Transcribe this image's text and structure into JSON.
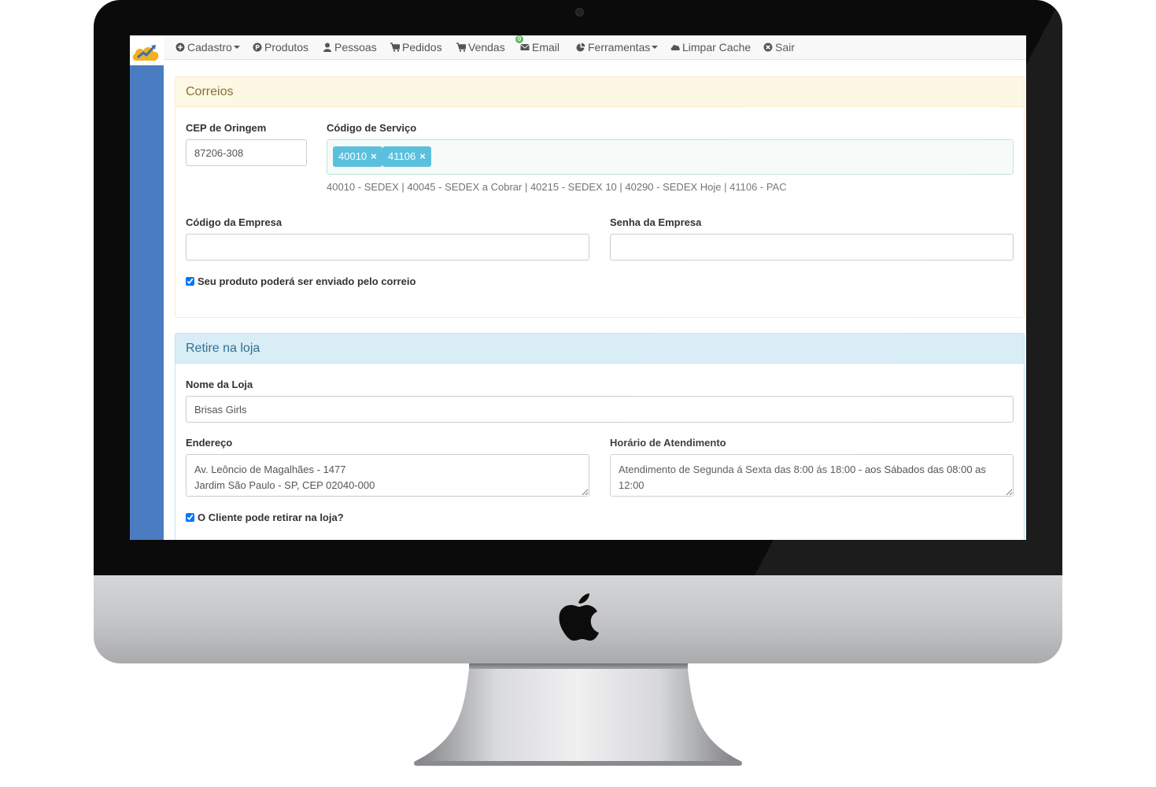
{
  "navbar": {
    "items": [
      {
        "label": "Cadastro",
        "icon": "plus-circle-icon",
        "dropdown": true
      },
      {
        "label": "Produtos",
        "icon": "p-circle-icon",
        "dropdown": false
      },
      {
        "label": "Pessoas",
        "icon": "user-icon",
        "dropdown": false
      },
      {
        "label": "Pedidos",
        "icon": "cart-icon",
        "dropdown": false
      },
      {
        "label": "Vendas",
        "icon": "cart-icon",
        "dropdown": false
      },
      {
        "label": "Email",
        "icon": "envelope-icon",
        "dropdown": false,
        "badge": "0"
      },
      {
        "label": "Ferramentas",
        "icon": "pie-chart-icon",
        "dropdown": true
      },
      {
        "label": "Limpar Cache",
        "icon": "cloud-icon",
        "dropdown": false
      },
      {
        "label": "Sair",
        "icon": "x-circle-icon",
        "dropdown": false
      }
    ]
  },
  "correios": {
    "title": "Correios",
    "cep_label": "CEP de Oringem",
    "cep_value": "87206-308",
    "servico_label": "Código de Serviço",
    "servico_tags": [
      "40010",
      "41106"
    ],
    "servico_help": "40010 - SEDEX | 40045 - SEDEX a Cobrar | 40215 - SEDEX 10 | 40290 - SEDEX Hoje | 41106 - PAC",
    "empresa_label": "Código da Empresa",
    "empresa_value": "",
    "senha_label": "Senha da Empresa",
    "senha_value": "",
    "enviar_checkbox_label": "Seu produto poderá ser enviado pelo correio",
    "enviar_checked": true
  },
  "retire": {
    "title": "Retire na loja",
    "nome_label": "Nome da Loja",
    "nome_value": "Brisas Girls",
    "endereco_label": "Endereço",
    "endereco_value": "Av. Leôncio de Magalhães - 1477\nJardim São Paulo - SP, CEP 02040-000",
    "horario_label": "Horário de Atendimento",
    "horario_value": "Atendimento de Segunda á Sexta das 8:00 ás 18:00 - aos Sábados das 08:00 as 12:00",
    "retirar_checkbox_label": "O Cliente pode retirar na loja?",
    "retirar_checked": true
  },
  "colors": {
    "sidebar": "#4a7cc1",
    "tag": "#5bc0de",
    "warning_heading": "#fcf8e3",
    "info_heading": "#d9edf7"
  }
}
